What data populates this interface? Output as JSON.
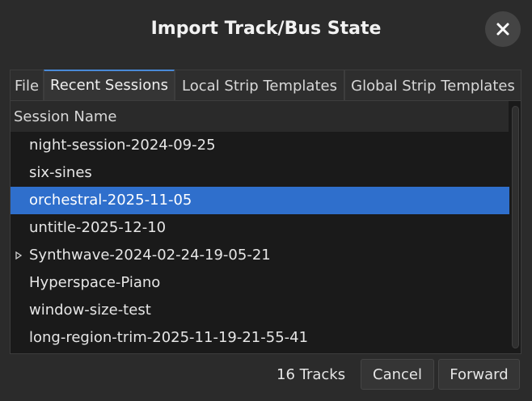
{
  "window": {
    "title": "Import Track/Bus State",
    "close_icon": "close-icon"
  },
  "tabs": [
    {
      "label": "File",
      "active": false
    },
    {
      "label": "Recent Sessions",
      "active": true
    },
    {
      "label": "Local Strip Templates",
      "active": false
    },
    {
      "label": "Global Strip Templates",
      "active": false
    }
  ],
  "list": {
    "column_header": "Session Name",
    "rows": [
      {
        "label": "night-session-2024-09-25",
        "selected": false,
        "expandable": false
      },
      {
        "label": "six-sines",
        "selected": false,
        "expandable": false
      },
      {
        "label": "orchestral-2025-11-05",
        "selected": true,
        "expandable": false
      },
      {
        "label": "untitle-2025-12-10",
        "selected": false,
        "expandable": false
      },
      {
        "label": "Synthwave-2024-02-24-19-05-21",
        "selected": false,
        "expandable": true
      },
      {
        "label": "Hyperspace-Piano",
        "selected": false,
        "expandable": false
      },
      {
        "label": "window-size-test",
        "selected": false,
        "expandable": false
      },
      {
        "label": "long-region-trim-2025-11-19-21-55-41",
        "selected": false,
        "expandable": false
      }
    ]
  },
  "footer": {
    "track_count": "16 Tracks",
    "cancel_label": "Cancel",
    "forward_label": "Forward"
  },
  "colors": {
    "selection": "#2f6fcc",
    "active_tab_accent": "#4a8ad8",
    "background": "#2b2b2b",
    "list_background": "#1a1a1a"
  }
}
